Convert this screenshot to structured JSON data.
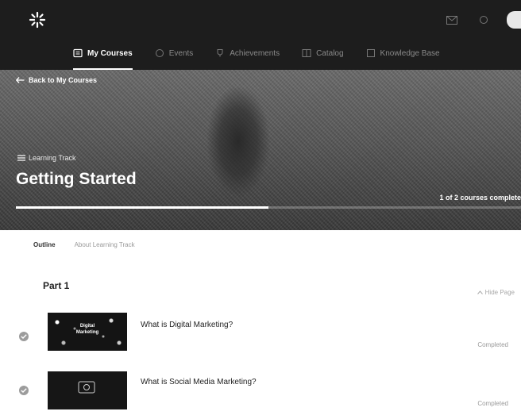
{
  "header": {
    "logo_icon": "starburst-logo-icon",
    "icons": [
      "mail-icon",
      "notifications-icon"
    ],
    "nav": [
      {
        "label": "My Courses",
        "icon": "book-icon",
        "active": true
      },
      {
        "label": "Events",
        "icon": "calendar-icon",
        "active": false
      },
      {
        "label": "Achievements",
        "icon": "trophy-icon",
        "active": false
      },
      {
        "label": "Catalog",
        "icon": "catalog-icon",
        "active": false
      },
      {
        "label": "Knowledge Base",
        "icon": "knowledge-icon",
        "active": false
      }
    ]
  },
  "hero": {
    "back_label": "Back to My Courses",
    "track_label": "Learning Track",
    "title": "Getting Started",
    "progress_text": "1 of 2 courses complete",
    "progress_fraction": 0.5
  },
  "tabs": [
    {
      "label": "Outline",
      "active": true
    },
    {
      "label": "About Learning Track",
      "active": false
    }
  ],
  "part": {
    "title": "Part 1",
    "hide_label": "Hide Page"
  },
  "courses": [
    {
      "title": "What is Digital Marketing?",
      "status": "Completed",
      "thumb_text": "Digital Marketing"
    },
    {
      "title": "What is Social Media Marketing?",
      "status": "Completed",
      "thumb_text": ""
    }
  ],
  "colors": {
    "header_bg": "#1d1d1d",
    "accent": "#ffffff"
  }
}
